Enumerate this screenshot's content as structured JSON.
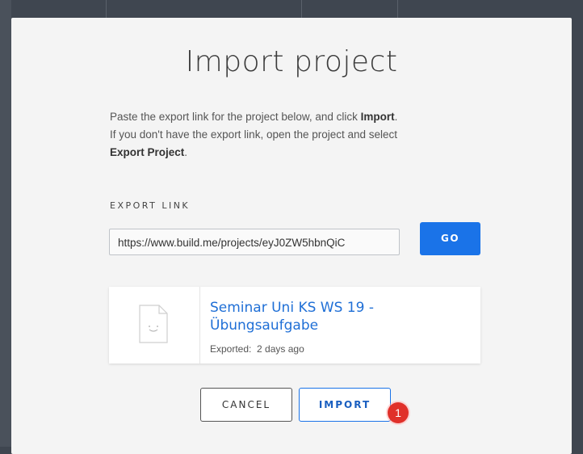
{
  "modal": {
    "title": "Import project",
    "description": {
      "line1_prefix": "Paste the export link for the project below, and click ",
      "line1_bold": "Import",
      "line1_suffix": ".",
      "line2": "If you don't have the export link, open the project and select",
      "line3_bold": "Export Project",
      "line3_suffix": "."
    },
    "export_link": {
      "label": "EXPORT LINK",
      "value": "https://www.build.me/projects/eyJ0ZW5hbnQiC"
    },
    "go_label": "GO",
    "project_card": {
      "icon": "document-icon",
      "title": "Seminar Uni KS WS 19 - Übungsaufgabe",
      "exported_label": "Exported:",
      "exported_value": "2 days ago"
    },
    "cancel_label": "CANCEL",
    "import_label": "IMPORT",
    "annotation_badge": "1"
  },
  "colors": {
    "accent": "#1a73e8",
    "badge": "#e0302a",
    "backdrop": "#3f4650"
  }
}
